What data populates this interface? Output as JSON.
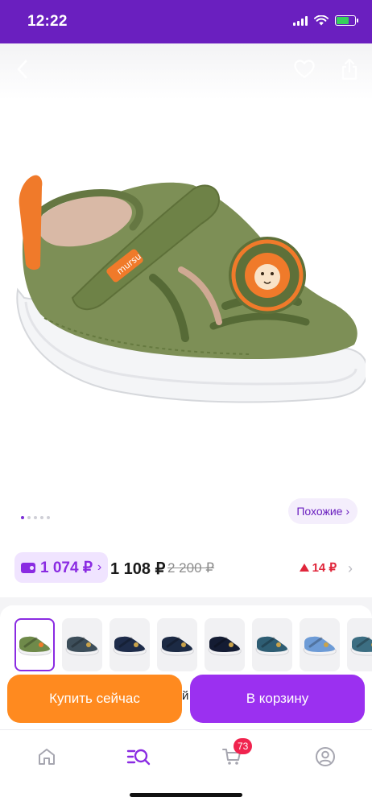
{
  "status_bar": {
    "time": "12:22"
  },
  "product": {
    "similar_label": "Похожие ›",
    "image_count": 5,
    "active_image": 1
  },
  "price": {
    "wallet_price": "1 074 ₽",
    "wallet_chevron": "›",
    "current": "1 108 ₽",
    "old": "2 200 ₽",
    "bonus": "14 ₽",
    "row_chevron": "›"
  },
  "variants": {
    "count": 8,
    "selected_index": 0,
    "colors": [
      "#6f8a4a",
      "#3d4e5a",
      "#1e2c4a",
      "#1c2a44",
      "#141c33",
      "#2e5d73",
      "#6d9bd6",
      "#3c6e82"
    ]
  },
  "actions": {
    "buy_now": "Купить сейчас",
    "add_to_cart": "В корзину",
    "peek_char": "й"
  },
  "tab_bar": {
    "cart_count": "73",
    "active_tab": "catalog"
  },
  "colors": {
    "brand": "#6a1fbf",
    "accent_purple": "#9b30f0",
    "accent_orange": "#ff8a1f",
    "badge_red": "#f0234e",
    "bonus_red": "#e0263b"
  }
}
